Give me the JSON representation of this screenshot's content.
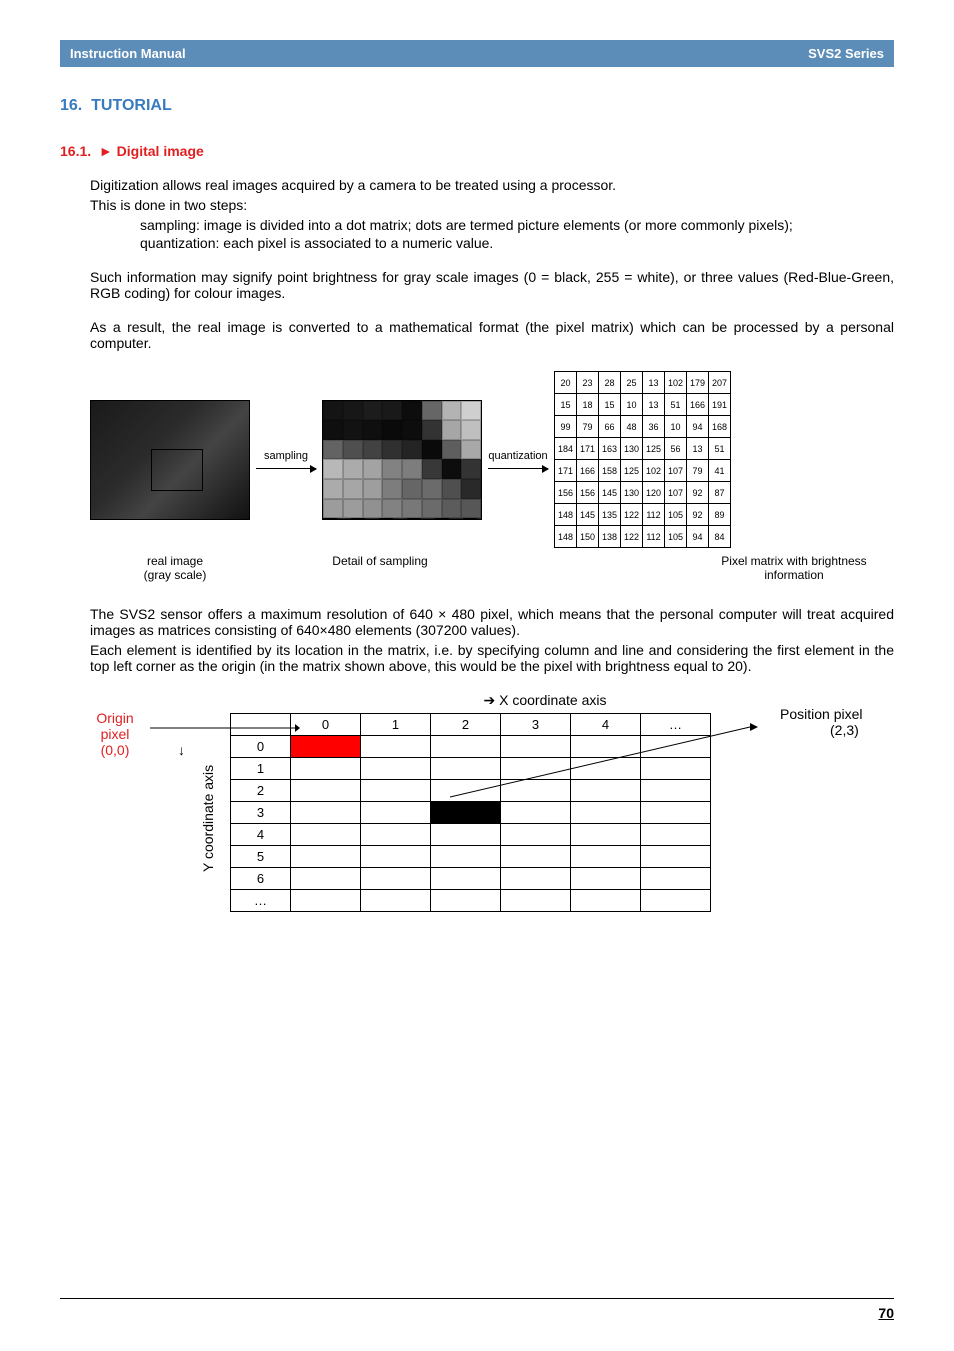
{
  "header": {
    "left": "Instruction Manual",
    "right": "SVS2 Series"
  },
  "headings": {
    "main_num": "16.",
    "main_text": "TUTORIAL",
    "sub_num": "16.1.",
    "sub_marker": "►",
    "sub_text": "Digital image"
  },
  "paragraphs": {
    "intro1": "Digitization allows real images acquired by a camera to be treated using a processor.",
    "intro2": "This is done in two steps:",
    "step_sampling": "sampling: image is divided into a dot matrix; dots are termed picture elements (or more commonly pixels);",
    "step_quant": "quantization: each pixel is associated to a numeric value.",
    "info": "Such information may signify point brightness for gray scale images (0 = black, 255 = white), or three values (Red-Blue-Green, RGB coding) for colour images.",
    "result": "As a result, the real image is converted to a mathematical format (the pixel matrix)  which can be processed by a personal computer.",
    "after1": "The SVS2 sensor offers a maximum resolution of 640 × 480 pixel, which means that the personal computer will treat acquired images as matrices consisting of 640×480 elements (307200 values).",
    "after2": "Each element is identified by its location in the matrix, i.e. by specifying column and line and considering the first element in the top left corner as the origin (in the matrix shown above, this would be the pixel with brightness equal to 20)."
  },
  "figure_labels": {
    "sampling": "sampling",
    "quantization": "quantization",
    "caption_real": "real image\n(gray scale)",
    "caption_detail": "Detail of sampling",
    "caption_matrix": "Pixel matrix with brightness information"
  },
  "chart_data": {
    "type": "table",
    "title": "Pixel matrix with brightness information",
    "rows": [
      [
        20,
        23,
        28,
        25,
        13,
        102,
        179,
        207
      ],
      [
        15,
        18,
        15,
        10,
        13,
        51,
        166,
        191
      ],
      [
        99,
        79,
        66,
        48,
        36,
        10,
        94,
        168
      ],
      [
        184,
        171,
        163,
        130,
        125,
        56,
        13,
        51
      ],
      [
        171,
        166,
        158,
        125,
        102,
        107,
        79,
        41
      ],
      [
        156,
        156,
        145,
        130,
        120,
        107,
        92,
        87
      ],
      [
        148,
        145,
        135,
        122,
        112,
        105,
        92,
        89
      ],
      [
        148,
        150,
        138,
        122,
        112,
        105,
        94,
        84
      ]
    ]
  },
  "coord": {
    "x_axis_title": "➔ X coordinate axis",
    "y_arrow": "↓",
    "y_axis_title": "Y coordinate axis",
    "origin_l1": "Origin",
    "origin_l2": "pixel",
    "origin_l3": "(0,0)",
    "pos_l1": "Position pixel",
    "pos_l2": "(2,3)",
    "col_headers": [
      "0",
      "1",
      "2",
      "3",
      "4",
      "…"
    ],
    "row_headers": [
      "0",
      "1",
      "2",
      "3",
      "4",
      "5",
      "6",
      "…"
    ]
  },
  "page_number": "70"
}
